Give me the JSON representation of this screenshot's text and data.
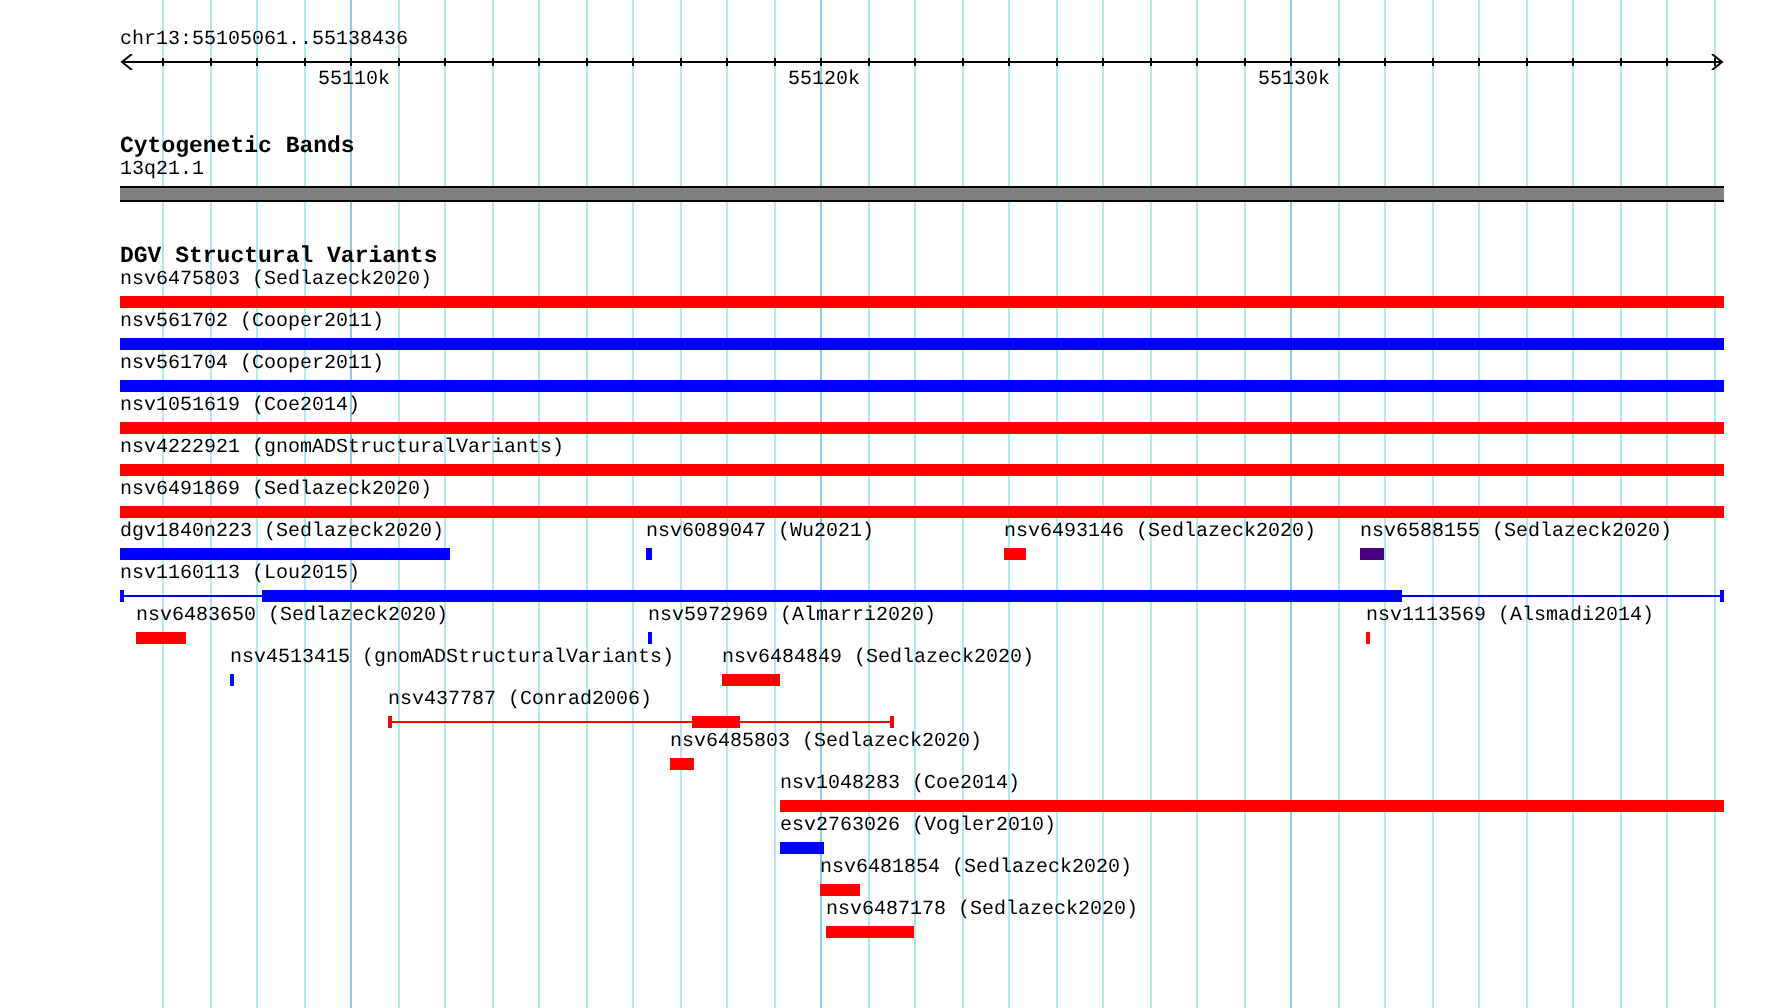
{
  "ruler": {
    "location": "chr13:55105061..55138436",
    "ticks": [
      "55110k",
      "55120k",
      "55130k"
    ]
  },
  "tracks": [
    {
      "title": "Cytogenetic Bands",
      "kind": "bands",
      "bands": [
        {
          "label": "13q21.1"
        }
      ]
    },
    {
      "title": "DGV Structural Variants",
      "kind": "features",
      "rows": [
        {
          "features": [
            {
              "label": "nsv6475803 (Sedlazeck2020)",
              "color": "#ff0000",
              "kind": "bar"
            }
          ]
        },
        {
          "features": [
            {
              "label": "nsv561702 (Cooper2011)",
              "color": "#0000ff",
              "kind": "bar"
            }
          ]
        },
        {
          "features": [
            {
              "label": "nsv561704 (Cooper2011)",
              "color": "#0000ff",
              "kind": "bar"
            }
          ]
        },
        {
          "features": [
            {
              "label": "nsv1051619 (Coe2014)",
              "color": "#ff0000",
              "kind": "bar"
            }
          ]
        },
        {
          "features": [
            {
              "label": "nsv4222921 (gnomADStructuralVariants)",
              "color": "#ff0000",
              "kind": "bar"
            }
          ]
        },
        {
          "features": [
            {
              "label": "nsv6491869 (Sedlazeck2020)",
              "color": "#ff0000",
              "kind": "bar"
            }
          ]
        },
        {
          "features": [
            {
              "label": "dgv1840n223 (Sedlazeck2020)",
              "color": "#0000ff",
              "kind": "bar"
            },
            {
              "label": "nsv6089047 (Wu2021)",
              "color": "#0000ff",
              "kind": "bar"
            },
            {
              "label": "nsv6493146 (Sedlazeck2020)",
              "color": "#ff0000",
              "kind": "bar"
            },
            {
              "label": "nsv6588155 (Sedlazeck2020)",
              "color": "#4b0082",
              "kind": "bar"
            }
          ]
        },
        {
          "features": [
            {
              "label": "nsv1160113 (Lou2015)",
              "color": "#0000ff",
              "kind": "gapped"
            }
          ]
        },
        {
          "features": [
            {
              "label": "nsv6483650 (Sedlazeck2020)",
              "color": "#ff0000",
              "kind": "bar"
            },
            {
              "label": "nsv5972969 (Almarri2020)",
              "color": "#0000ff",
              "kind": "bar"
            },
            {
              "label": "nsv1113569 (Alsmadi2014)",
              "color": "#ff0000",
              "kind": "bar"
            }
          ]
        },
        {
          "features": [
            {
              "label": "nsv4513415 (gnomADStructuralVariants)",
              "color": "#0000ff",
              "kind": "bar"
            },
            {
              "label": "nsv6484849 (Sedlazeck2020)",
              "color": "#ff0000",
              "kind": "bar"
            }
          ]
        },
        {
          "features": [
            {
              "label": "nsv437787 (Conrad2006)",
              "color": "#ff0000",
              "kind": "gapped"
            }
          ]
        },
        {
          "features": [
            {
              "label": "nsv6485803 (Sedlazeck2020)",
              "color": "#ff0000",
              "kind": "bar"
            }
          ]
        },
        {
          "features": [
            {
              "label": "nsv1048283 (Coe2014)",
              "color": "#ff0000",
              "kind": "bar"
            }
          ]
        },
        {
          "features": [
            {
              "label": "esv2763026 (Vogler2010)",
              "color": "#0000ff",
              "kind": "bar"
            }
          ]
        },
        {
          "features": [
            {
              "label": "nsv6481854 (Sedlazeck2020)",
              "color": "#ff0000",
              "kind": "bar"
            }
          ]
        },
        {
          "features": [
            {
              "label": "nsv6487178 (Sedlazeck2020)",
              "color": "#ff0000",
              "kind": "bar"
            }
          ]
        }
      ]
    }
  ]
}
